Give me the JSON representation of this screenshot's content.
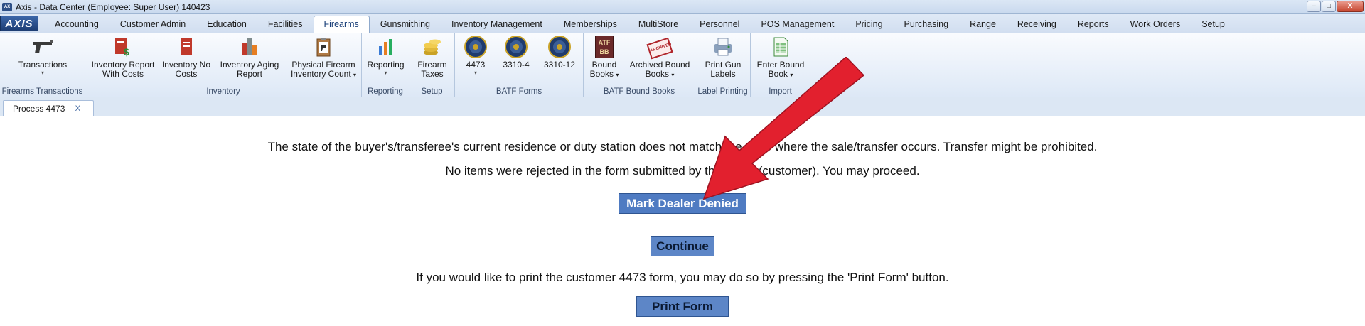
{
  "window": {
    "title": "Axis - Data Center  (Employee: Super User) 140423",
    "logo_text": "AXIS",
    "minimize": "–",
    "maximize": "□",
    "close": "X"
  },
  "menu_tabs": [
    {
      "label": "Accounting"
    },
    {
      "label": "Customer Admin"
    },
    {
      "label": "Education"
    },
    {
      "label": "Facilities"
    },
    {
      "label": "Firearms",
      "active": true
    },
    {
      "label": "Gunsmithing"
    },
    {
      "label": "Inventory Management"
    },
    {
      "label": "Memberships"
    },
    {
      "label": "MultiStore"
    },
    {
      "label": "Personnel"
    },
    {
      "label": "POS Management"
    },
    {
      "label": "Pricing"
    },
    {
      "label": "Purchasing"
    },
    {
      "label": "Range"
    },
    {
      "label": "Receiving"
    },
    {
      "label": "Reports"
    },
    {
      "label": "Work Orders"
    },
    {
      "label": "Setup"
    }
  ],
  "ribbon": {
    "groups": {
      "firearms_transactions": "Firearms Transactions",
      "inventory": "Inventory",
      "reporting": "Reporting",
      "setup": "Setup",
      "batf_forms": "BATF Forms",
      "batf_bound_books": "BATF Bound Books",
      "label_printing": "Label Printing",
      "import": "Import"
    },
    "buttons": {
      "transactions": "Transactions",
      "inv_report_costs_1": "Inventory Report",
      "inv_report_costs_2": "With Costs",
      "inv_no_costs_1": "Inventory No",
      "inv_no_costs_2": "Costs",
      "inv_aging_1": "Inventory Aging",
      "inv_aging_2": "Report",
      "phys_count_1": "Physical Firearm",
      "phys_count_2": "Inventory Count",
      "reporting": "Reporting",
      "firearm_taxes_1": "Firearm",
      "firearm_taxes_2": "Taxes",
      "form_4473": "4473",
      "form_3310_4": "3310-4",
      "form_3310_12": "3310-12",
      "bound_books_1": "Bound",
      "bound_books_2": "Books",
      "archived_1": "Archived Bound",
      "archived_2": "Books",
      "print_labels_1": "Print Gun",
      "print_labels_2": "Labels",
      "enter_bound_1": "Enter Bound",
      "enter_bound_2": "Book"
    },
    "icons": {
      "pistol": "pistol-icon",
      "report_money": "report-costs-icon",
      "report": "report-icon",
      "aging": "aging-chart-icon",
      "clipboard": "clipboard-icon",
      "chart": "bar-chart-icon",
      "coins": "coins-icon",
      "seal": "batf-seal-icon",
      "atf_books": "atf-books-icon",
      "archived": "archived-stamp-icon",
      "printer": "label-printer-icon",
      "spreadsheet": "spreadsheet-icon"
    },
    "atf_text": "ATF BB",
    "archived_stamp": "ARCHIVED"
  },
  "doc_tab": {
    "label": "Process 4473",
    "close": "X"
  },
  "content": {
    "message_1": "The state of the buyer's/transferee's current residence or duty station does not match the state where the sale/transfer occurs.  Transfer might be prohibited.",
    "message_2": "No items were rejected in the form submitted by the buyer (customer).  You may proceed.",
    "mark_denied": "Mark Dealer Denied",
    "continue": "Continue",
    "print_info": "If you would like to print the customer 4473 form, you may do so by pressing the 'Print Form' button.",
    "print_form": "Print Form"
  },
  "colors": {
    "arrow": "#e2202e",
    "button_bg": "#4f7bc2",
    "ribbon_bg": "#dde8f6"
  }
}
